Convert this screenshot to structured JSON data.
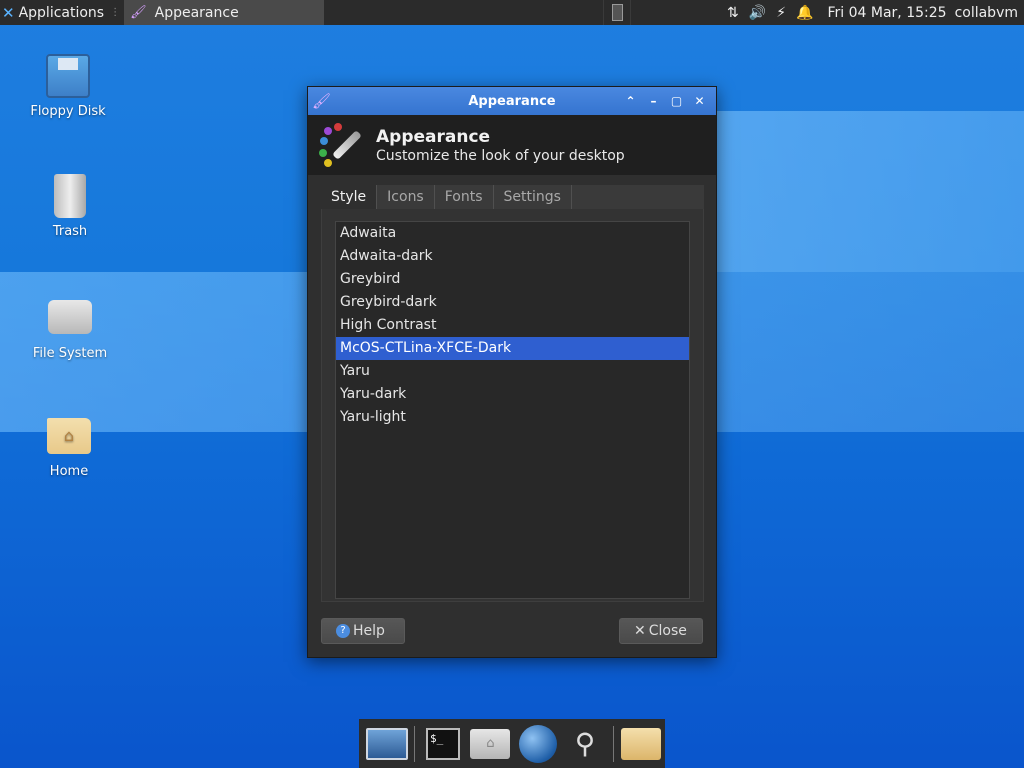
{
  "top_panel": {
    "applications_label": "Applications",
    "task_label": "Appearance",
    "clock": "Fri 04 Mar, 15:25",
    "user": "collabvm"
  },
  "desktop": {
    "icons": [
      {
        "label": "Floppy Disk"
      },
      {
        "label": "Trash"
      },
      {
        "label": "File System"
      },
      {
        "label": "Home"
      }
    ]
  },
  "window": {
    "title": "Appearance",
    "header_title": "Appearance",
    "header_subtitle": "Customize the look of your desktop",
    "tabs": [
      {
        "label": "Style",
        "active": true
      },
      {
        "label": "Icons"
      },
      {
        "label": "Fonts"
      },
      {
        "label": "Settings"
      }
    ],
    "themes": [
      "Adwaita",
      "Adwaita-dark",
      "Greybird",
      "Greybird-dark",
      "High Contrast",
      "McOS-CTLina-XFCE-Dark",
      "Yaru",
      "Yaru-dark",
      "Yaru-light"
    ],
    "selected_theme": "McOS-CTLina-XFCE-Dark",
    "help_label": "Help",
    "close_label": "Close"
  },
  "colors": {
    "accent": "#2f5fd0",
    "titlebar": "#3f7fd8"
  }
}
